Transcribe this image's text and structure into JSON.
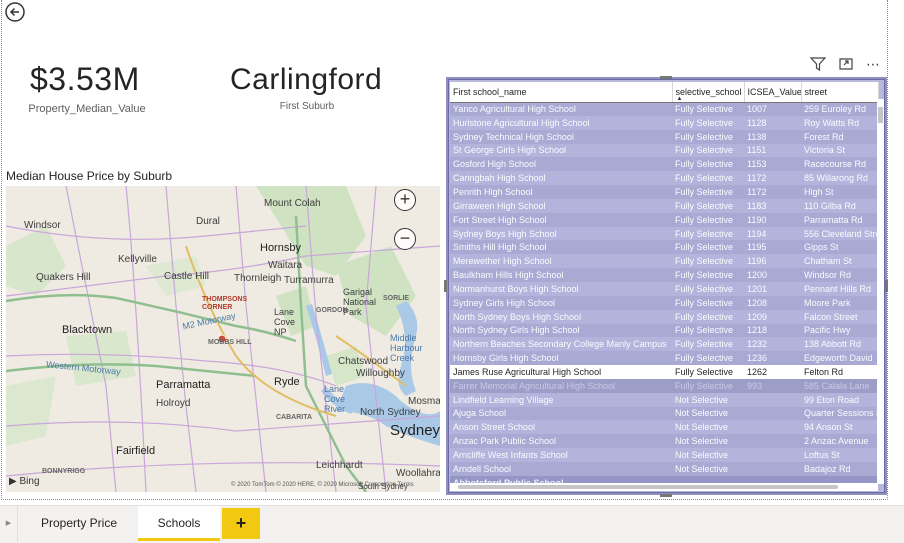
{
  "header": {
    "back_icon": "back-arrow-icon"
  },
  "cards": [
    {
      "value": "$3.53M",
      "label": "Property_Median_Value"
    },
    {
      "value": "Carlingford",
      "label": "First Suburb"
    }
  ],
  "map": {
    "title": "Median House Price by Suburb",
    "zoom_in": "+",
    "zoom_out": "−",
    "bing_label": "Bing",
    "copyright": "© 2020 TomTom © 2020 HERE, © 2020 Microsoft Corporation Terms",
    "labels": {
      "windsor": "Windsor",
      "dural": "Dural",
      "mount_colah": "Mount Colah",
      "hornsby": "Hornsby",
      "waitara": "Waitara",
      "kellyville": "Kellyville",
      "quakers_hill": "Quakers Hill",
      "castle_hill": "Castle Hill",
      "thornleigh": "Thornleigh",
      "turramurra": "Turramurra",
      "thompsons_corner": "THOMPSONS CORNER",
      "gordon": "GORDON",
      "garigal": "Garigal National Park",
      "sorlie": "SORLIE",
      "blacktown": "Blacktown",
      "m2": "M2 Motorway",
      "lane_cove": "Lane Cove NP",
      "middle_harbour": "Middle Harbour Creek",
      "mobbs_hill": "MOBBS HILL",
      "chatswood": "Chatswood",
      "willoughby": "Willoughby",
      "western_mwy": "Western Motorway",
      "parramatta": "Parramatta",
      "ryde": "Ryde",
      "holroyd": "Holroyd",
      "cabarita": "CABARITA",
      "lane_cove_river": "Lane Cove River",
      "north_sydney": "North Sydney",
      "mosman": "Mosman",
      "sydney": "Sydney",
      "fairfield": "Fairfield",
      "bonnyrigg": "BONNYRIGG",
      "leichhardt": "Leichhardt",
      "woollahra": "Woollahra",
      "south_sydney": "South Sydney"
    }
  },
  "table": {
    "icons": [
      "filter-icon",
      "focus-mode-icon",
      "more-options-icon"
    ],
    "columns": [
      "First school_name",
      "selective_school",
      "ICSEA_Value",
      "street"
    ],
    "rows": [
      [
        "Yanco Agricultural High School",
        "Fully Selective",
        "1007",
        "259 Euroley Rd"
      ],
      [
        "Hurlstone Agricultural High School",
        "Fully Selective",
        "1128",
        "Roy Watts Rd"
      ],
      [
        "Sydney Technical High School",
        "Fully Selective",
        "1138",
        "Forest Rd"
      ],
      [
        "St George Girls High School",
        "Fully Selective",
        "1151",
        "Victoria St"
      ],
      [
        "Gosford High School",
        "Fully Selective",
        "1153",
        "Racecourse Rd"
      ],
      [
        "Caringbah High School",
        "Fully Selective",
        "1172",
        "85 Willarong Rd"
      ],
      [
        "Penrith High School",
        "Fully Selective",
        "1172",
        "High St"
      ],
      [
        "Girraween High School",
        "Fully Selective",
        "1183",
        "110 Gilba Rd"
      ],
      [
        "Fort Street High School",
        "Fully Selective",
        "1190",
        "Parramatta Rd"
      ],
      [
        "Sydney Boys High School",
        "Fully Selective",
        "1194",
        "556 Cleveland Stre"
      ],
      [
        "Smiths Hill High School",
        "Fully Selective",
        "1195",
        "Gipps St"
      ],
      [
        "Merewether High School",
        "Fully Selective",
        "1196",
        "Chatham St"
      ],
      [
        "Baulkham Hills High School",
        "Fully Selective",
        "1200",
        "Windsor Rd"
      ],
      [
        "Normanhurst Boys High School",
        "Fully Selective",
        "1201",
        "Pennant Hills Rd"
      ],
      [
        "Sydney Girls High School",
        "Fully Selective",
        "1208",
        "Moore Park"
      ],
      [
        "North Sydney Boys High School",
        "Fully Selective",
        "1209",
        "Falcon Street"
      ],
      [
        "North Sydney Girls High School",
        "Fully Selective",
        "1218",
        "Pacific Hwy"
      ],
      [
        "Northern Beaches Secondary College Manly Campus",
        "Fully Selective",
        "1232",
        "138 Abbott Rd"
      ],
      [
        "Hornsby Girls High School",
        "Fully Selective",
        "1236",
        "Edgeworth David"
      ],
      [
        "James Ruse Agricultural High School",
        "Fully Selective",
        "1262",
        "Felton Rd"
      ],
      [
        "Farrer Memorial Agricultural High School",
        "Fully Selective",
        "993",
        "585 Calala Lane"
      ],
      [
        "Lindfield Learning Village",
        "Not Selective",
        "",
        "99 Eton Road"
      ],
      [
        "Ajuga School",
        "Not Selective",
        "",
        "Quarter Sessions R"
      ],
      [
        "Anson Street School",
        "Not Selective",
        "",
        "94 Anson St"
      ],
      [
        "Anzac Park Public School",
        "Not Selective",
        "",
        "2 Anzac Avenue"
      ],
      [
        "Arncliffe West Infants School",
        "Not Selective",
        "",
        "Loftus St"
      ],
      [
        "Arndell School",
        "Not Selective",
        "",
        "Badajoz Rd"
      ],
      [
        "Abbotsford Public School",
        "",
        "",
        ""
      ]
    ],
    "highlight_row": 19
  },
  "tabs": {
    "items": [
      "Property Price",
      "Schools"
    ],
    "active": "Schools",
    "add_label": "+"
  }
}
